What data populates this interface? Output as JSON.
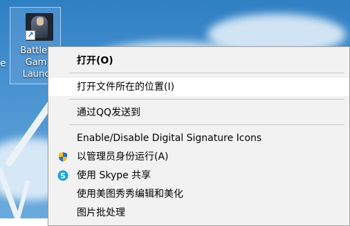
{
  "desktop": {
    "left_edge_text": "e",
    "icon": {
      "label": "Battles\nGam\nLaunc",
      "shortcut_arrow": "↗"
    }
  },
  "menu": {
    "open": "打开(O)",
    "open_location": "打开文件所在的位置(I)",
    "send_qq": "通过QQ发送到",
    "signature": "Enable/Disable Digital Signature Icons",
    "run_admin": "以管理员身份运行(A)",
    "skype_share": "使用 Skype 共享",
    "meitu": "使用美图秀秀编辑和美化",
    "batch": "图片批处理"
  },
  "colors": {
    "menu_bg": "#f2f2f2",
    "hover_bg": "#ffffff",
    "separator": "#c8c8c8",
    "skype": "#1aa3e0",
    "shield_blue": "#2b6ccd",
    "shield_yellow": "#f2c318"
  },
  "icons": {
    "shield": "uac-shield-icon",
    "skype": "skype-icon"
  }
}
